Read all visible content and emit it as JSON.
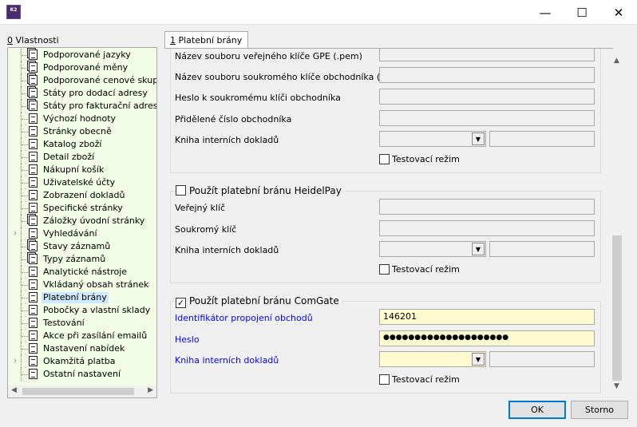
{
  "window": {
    "app_icon_text": "K2",
    "minimize_glyph": "—",
    "maximize_glyph": "☐",
    "close_glyph": "✕"
  },
  "left_panel": {
    "label_prefix": "0",
    "label_rest": " Vlastnosti",
    "items": [
      {
        "label": "Podporované jazyky",
        "icon": "multi-document-icon"
      },
      {
        "label": "Podporované měny",
        "icon": "multi-document-icon"
      },
      {
        "label": "Podporované cenové skupiny",
        "icon": "multi-document-icon"
      },
      {
        "label": "Státy pro dodací adresy",
        "icon": "multi-document-icon"
      },
      {
        "label": "Státy pro fakturační adresy",
        "icon": "multi-document-icon"
      },
      {
        "label": "Výchozí hodnoty",
        "icon": "document-icon"
      },
      {
        "label": "Stránky obecně",
        "icon": "document-icon"
      },
      {
        "label": "Katalog zboží",
        "icon": "document-icon"
      },
      {
        "label": "Detail zboží",
        "icon": "document-icon"
      },
      {
        "label": "Nákupní košík",
        "icon": "document-icon"
      },
      {
        "label": "Uživatelské účty",
        "icon": "document-icon"
      },
      {
        "label": "Zobrazení dokladů",
        "icon": "document-icon"
      },
      {
        "label": "Specifické stránky",
        "icon": "document-icon"
      },
      {
        "label": "Záložky úvodní stránky",
        "icon": "multi-document-icon"
      },
      {
        "label": "Vyhledávání",
        "icon": "document-icon",
        "expandable": true
      },
      {
        "label": "Stavy záznamů",
        "icon": "multi-document-icon"
      },
      {
        "label": "Typy záznamů",
        "icon": "multi-document-icon"
      },
      {
        "label": "Analytické nástroje",
        "icon": "document-icon"
      },
      {
        "label": "Vkládaný obsah stránek",
        "icon": "document-icon"
      },
      {
        "label": "Platební brány",
        "icon": "document-icon",
        "selected": true
      },
      {
        "label": "Pobočky a vlastní sklady",
        "icon": "document-icon"
      },
      {
        "label": "Testování",
        "icon": "document-icon"
      },
      {
        "label": "Akce při zasílání emailů",
        "icon": "document-icon"
      },
      {
        "label": "Nastavení nabídek",
        "icon": "document-icon"
      },
      {
        "label": "Okamžitá platba",
        "icon": "document-icon",
        "expandable": true
      },
      {
        "label": "Ostatní nastavení",
        "icon": "document-icon"
      }
    ]
  },
  "tab": {
    "prefix": "1",
    "rest": " Platební brány"
  },
  "gpe_group": {
    "rows": [
      {
        "label": "Název souboru veřejného klíče GPE (.pem)"
      },
      {
        "label": "Název souboru soukromého klíče obchodníka (.key)"
      },
      {
        "label": "Heslo k soukromému klíči obchodníka"
      },
      {
        "label": "Přidělené číslo obchodníka"
      },
      {
        "label": "Kniha interních dokladů"
      }
    ],
    "test_mode_label": "Testovací režim"
  },
  "heidelpay_group": {
    "title": "Použít platební bránu HeidelPay",
    "checked": false,
    "rows": [
      {
        "label": "Veřejný klíč"
      },
      {
        "label": "Soukromý klíč"
      },
      {
        "label": "Kniha interních dokladů"
      }
    ],
    "test_mode_label": "Testovací režim"
  },
  "comgate_group": {
    "title": "Použít platební bránu ComGate",
    "checked": true,
    "check_glyph": "✓",
    "id_label": "Identifikátor propojení obchodů",
    "id_value": "146201",
    "password_label": "Heslo",
    "password_value": "●●●●●●●●●●●●●●●●●●●●",
    "book_label": "Kniha interních dokladů",
    "test_mode_label": "Testovací režim"
  },
  "buttons": {
    "ok": "OK",
    "cancel": "Storno"
  },
  "colors": {
    "tree_bg": "#f1fbe6",
    "required_label": "#0000ff",
    "required_field": "#fffbd0",
    "ok_border": "#0078d7",
    "selected_item": "#cde8ff"
  }
}
